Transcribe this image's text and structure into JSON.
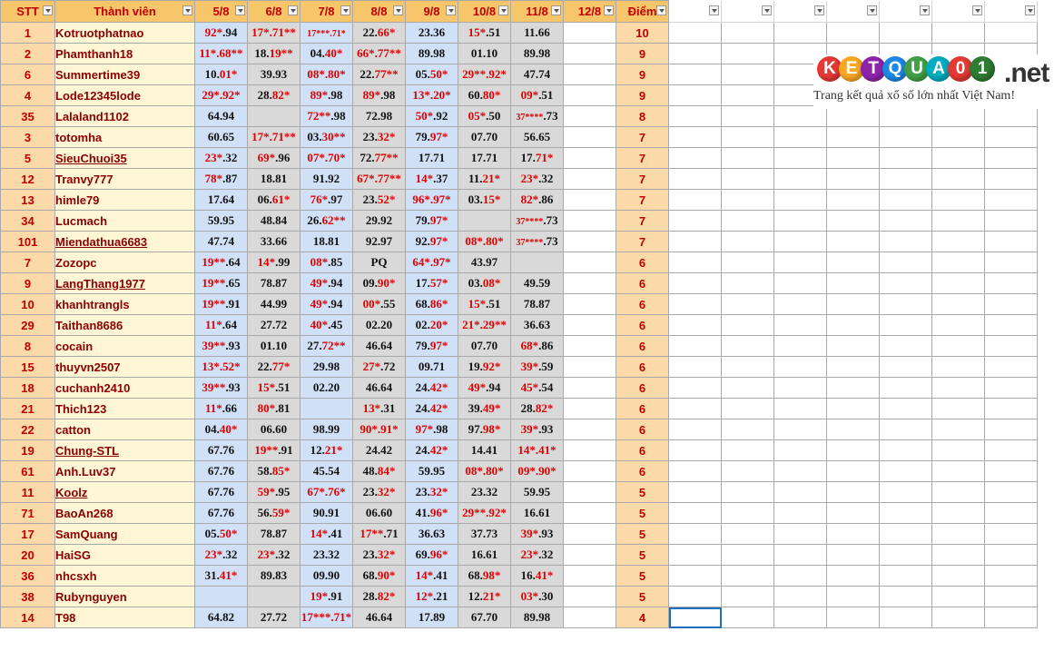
{
  "sheet": {
    "headers": {
      "stt": "STT",
      "name": "Thành viên",
      "dates": [
        "5/8",
        "6/8",
        "7/8",
        "8/8",
        "9/8",
        "10/8",
        "11/8",
        "12/8"
      ],
      "score": "Điểm"
    },
    "rows": [
      {
        "stt": "1",
        "name": "Kotruotphatnao",
        "link": false,
        "vals": [
          [
            "92*",
            ".94"
          ],
          [
            "17*.71**"
          ],
          [
            "$17***.71*"
          ],
          [
            "22.",
            "66*"
          ],
          [
            "23.36"
          ],
          [
            "15*",
            ".51"
          ],
          [
            "11.66"
          ],
          [
            ""
          ]
        ],
        "score": "10"
      },
      {
        "stt": "2",
        "name": "Phamthanh18",
        "link": false,
        "vals": [
          [
            "11*.68**"
          ],
          [
            "18.",
            "19**"
          ],
          [
            "04.",
            "40*"
          ],
          [
            "66*.77**"
          ],
          [
            "89.98"
          ],
          [
            "01.10"
          ],
          [
            "89.98"
          ],
          [
            ""
          ]
        ],
        "score": "9"
      },
      {
        "stt": "6",
        "name": "Summertime39",
        "link": false,
        "vals": [
          [
            "10.",
            "01*"
          ],
          [
            "39.93"
          ],
          [
            "08*.80*"
          ],
          [
            "22.",
            "77**"
          ],
          [
            "05.",
            "50*"
          ],
          [
            "29**.92*"
          ],
          [
            "47.74"
          ],
          [
            ""
          ]
        ],
        "score": "9"
      },
      {
        "stt": "4",
        "name": "Lode12345lode",
        "link": false,
        "vals": [
          [
            "29*.92*"
          ],
          [
            "28.",
            "82*"
          ],
          [
            "89*",
            ".98"
          ],
          [
            "89*",
            ".98"
          ],
          [
            "13*.20*"
          ],
          [
            "60.",
            "80*"
          ],
          [
            "09*",
            ".51"
          ],
          [
            ""
          ]
        ],
        "score": "9"
      },
      {
        "stt": "35",
        "name": "Lalaland1102",
        "link": false,
        "vals": [
          [
            "64.94"
          ],
          [
            ""
          ],
          [
            "72**",
            ".98"
          ],
          [
            "72.98"
          ],
          [
            "50*",
            ".92"
          ],
          [
            "05*",
            ".50"
          ],
          [
            "$37****",
            ".73"
          ],
          [
            ""
          ]
        ],
        "score": "8"
      },
      {
        "stt": "3",
        "name": "totomha",
        "link": false,
        "vals": [
          [
            "60.65"
          ],
          [
            "17*.71**"
          ],
          [
            "03.",
            "30**"
          ],
          [
            "23.",
            "32*"
          ],
          [
            "79.",
            "97*"
          ],
          [
            "07.70"
          ],
          [
            "56.65"
          ],
          [
            ""
          ]
        ],
        "score": "7"
      },
      {
        "stt": "5",
        "name": "SieuChuoi35",
        "link": true,
        "vals": [
          [
            "23*",
            ".32"
          ],
          [
            "69*",
            ".96"
          ],
          [
            "07*.70*"
          ],
          [
            "72.",
            "77**"
          ],
          [
            "17.71"
          ],
          [
            "17.71"
          ],
          [
            "17.",
            "71*"
          ],
          [
            ""
          ]
        ],
        "score": "7"
      },
      {
        "stt": "12",
        "name": "Tranvy777",
        "link": false,
        "vals": [
          [
            "78*",
            ".87"
          ],
          [
            "18.81"
          ],
          [
            "91.92"
          ],
          [
            "67*.77**"
          ],
          [
            "14*",
            ".37"
          ],
          [
            "11.",
            "21*"
          ],
          [
            "23*",
            ".32"
          ],
          [
            ""
          ]
        ],
        "score": "7"
      },
      {
        "stt": "13",
        "name": "himle79",
        "link": false,
        "vals": [
          [
            "17.64"
          ],
          [
            "06.",
            "61*"
          ],
          [
            "76*",
            ".97"
          ],
          [
            "23.",
            "52*"
          ],
          [
            "96*.97*"
          ],
          [
            "03.",
            "15*"
          ],
          [
            "82*",
            ".86"
          ],
          [
            ""
          ]
        ],
        "score": "7"
      },
      {
        "stt": "34",
        "name": "Lucmach",
        "link": false,
        "vals": [
          [
            "59.95"
          ],
          [
            "48.84"
          ],
          [
            "26.",
            "62**"
          ],
          [
            "29.92"
          ],
          [
            "79.",
            "97*"
          ],
          [
            ""
          ],
          [
            "$37****",
            ".73"
          ],
          [
            ""
          ]
        ],
        "score": "7"
      },
      {
        "stt": "101",
        "name": "Miendathua6683",
        "link": true,
        "vals": [
          [
            "47.74"
          ],
          [
            "33.66"
          ],
          [
            "18.81"
          ],
          [
            "92.97"
          ],
          [
            "92.",
            "97*"
          ],
          [
            "08*.80*"
          ],
          [
            "$37****",
            ".73"
          ],
          [
            ""
          ]
        ],
        "score": "7"
      },
      {
        "stt": "7",
        "name": "Zozopc",
        "link": false,
        "vals": [
          [
            "19**",
            ".64"
          ],
          [
            "14*",
            ".99"
          ],
          [
            "08*",
            ".85"
          ],
          [
            "PQ"
          ],
          [
            "64*.97*"
          ],
          [
            "43.97"
          ],
          [
            ""
          ],
          [
            ""
          ]
        ],
        "score": "6"
      },
      {
        "stt": "9",
        "name": "LangThang1977",
        "link": true,
        "vals": [
          [
            "19**",
            ".65"
          ],
          [
            "78.87"
          ],
          [
            "49*",
            ".94"
          ],
          [
            "09.",
            "90*"
          ],
          [
            "17.",
            "57*"
          ],
          [
            "03.",
            "08*"
          ],
          [
            "49.59"
          ],
          [
            ""
          ]
        ],
        "score": "6"
      },
      {
        "stt": "10",
        "name": "khanhtrangls",
        "link": false,
        "vals": [
          [
            "19**",
            ".91"
          ],
          [
            "44.99"
          ],
          [
            "49*",
            ".94"
          ],
          [
            "00*",
            ".55"
          ],
          [
            "68.",
            "86*"
          ],
          [
            "15*",
            ".51"
          ],
          [
            "78.87"
          ],
          [
            ""
          ]
        ],
        "score": "6"
      },
      {
        "stt": "29",
        "name": "Taithan8686",
        "link": false,
        "vals": [
          [
            "11*",
            ".64"
          ],
          [
            "27.72"
          ],
          [
            "40*",
            ".45"
          ],
          [
            "02.20"
          ],
          [
            "02.",
            "20*"
          ],
          [
            "21*.29**"
          ],
          [
            "36.63"
          ],
          [
            ""
          ]
        ],
        "score": "6"
      },
      {
        "stt": "8",
        "name": "cocain",
        "link": false,
        "vals": [
          [
            "39**",
            ".93"
          ],
          [
            "01.10"
          ],
          [
            "27.",
            "72**"
          ],
          [
            "46.64"
          ],
          [
            "79.",
            "97*"
          ],
          [
            "07.70"
          ],
          [
            "68*",
            ".86"
          ],
          [
            ""
          ]
        ],
        "score": "6"
      },
      {
        "stt": "15",
        "name": "thuyvn2507",
        "link": false,
        "vals": [
          [
            "13*.52*"
          ],
          [
            "22.",
            "77*"
          ],
          [
            "29.98"
          ],
          [
            "27*",
            ".72"
          ],
          [
            "09.71"
          ],
          [
            "19.",
            "92*"
          ],
          [
            "39*",
            ".59"
          ],
          [
            ""
          ]
        ],
        "score": "6"
      },
      {
        "stt": "18",
        "name": "cuchanh2410",
        "link": false,
        "vals": [
          [
            "39**",
            ".93"
          ],
          [
            "15*",
            ".51"
          ],
          [
            "02.20"
          ],
          [
            "46.64"
          ],
          [
            "24.",
            "42*"
          ],
          [
            "49*",
            ".94"
          ],
          [
            "45*",
            ".54"
          ],
          [
            ""
          ]
        ],
        "score": "6"
      },
      {
        "stt": "21",
        "name": "Thich123",
        "link": false,
        "vals": [
          [
            "11*",
            ".66"
          ],
          [
            "80*",
            ".81"
          ],
          [
            ""
          ],
          [
            "13*",
            ".31"
          ],
          [
            "24.",
            "42*"
          ],
          [
            "39.",
            "49*"
          ],
          [
            "28.",
            "82*"
          ],
          [
            ""
          ]
        ],
        "score": "6"
      },
      {
        "stt": "22",
        "name": "catton",
        "link": false,
        "vals": [
          [
            "04.",
            "40*"
          ],
          [
            "06.60"
          ],
          [
            "98.99"
          ],
          [
            "90*.91*"
          ],
          [
            "97*",
            ".98"
          ],
          [
            "97.",
            "98*"
          ],
          [
            "39*",
            ".93"
          ],
          [
            ""
          ]
        ],
        "score": "6"
      },
      {
        "stt": "19",
        "name": "Chung-STL",
        "link": true,
        "vals": [
          [
            "67.76"
          ],
          [
            "19**",
            ".91"
          ],
          [
            "12.",
            "21*"
          ],
          [
            "24.42"
          ],
          [
            "24.",
            "42*"
          ],
          [
            "14.41"
          ],
          [
            "14*.41*"
          ],
          [
            ""
          ]
        ],
        "score": "6"
      },
      {
        "stt": "61",
        "name": "Anh.Luv37",
        "link": false,
        "vals": [
          [
            "67.76"
          ],
          [
            "58.",
            "85*"
          ],
          [
            "45.54"
          ],
          [
            "48.",
            "84*"
          ],
          [
            "59.95"
          ],
          [
            "08*.80*"
          ],
          [
            "09*.90*"
          ],
          [
            ""
          ]
        ],
        "score": "6"
      },
      {
        "stt": "11",
        "name": "Koolz",
        "link": true,
        "vals": [
          [
            "67.76"
          ],
          [
            "59*",
            ".95"
          ],
          [
            "67*.76*"
          ],
          [
            "23.",
            "32*"
          ],
          [
            "23.",
            "32*"
          ],
          [
            "23.32"
          ],
          [
            "59.95"
          ],
          [
            ""
          ]
        ],
        "score": "5"
      },
      {
        "stt": "71",
        "name": "BaoAn268",
        "link": false,
        "vals": [
          [
            "67.76"
          ],
          [
            "56.",
            "59*"
          ],
          [
            "90.91"
          ],
          [
            "06.60"
          ],
          [
            "41.",
            "96*"
          ],
          [
            "29**.92*"
          ],
          [
            "16.61"
          ],
          [
            ""
          ]
        ],
        "score": "5"
      },
      {
        "stt": "17",
        "name": "SamQuang",
        "link": false,
        "vals": [
          [
            "05.",
            "50*"
          ],
          [
            "78.87"
          ],
          [
            "14*",
            ".41"
          ],
          [
            "17**",
            ".71"
          ],
          [
            "36.63"
          ],
          [
            "37.73"
          ],
          [
            "39*",
            ".93"
          ],
          [
            ""
          ]
        ],
        "score": "5"
      },
      {
        "stt": "20",
        "name": "HaiSG",
        "link": false,
        "vals": [
          [
            "23*",
            ".32"
          ],
          [
            "23*",
            ".32"
          ],
          [
            "23.32"
          ],
          [
            "23.",
            "32*"
          ],
          [
            "69.",
            "96*"
          ],
          [
            "16.61"
          ],
          [
            "23*",
            ".32"
          ],
          [
            ""
          ]
        ],
        "score": "5"
      },
      {
        "stt": "36",
        "name": "nhcsxh",
        "link": false,
        "vals": [
          [
            "31.",
            "41*"
          ],
          [
            "89.83"
          ],
          [
            "09.90"
          ],
          [
            "68.",
            "90*"
          ],
          [
            "14*",
            ".41"
          ],
          [
            "68.",
            "98*"
          ],
          [
            "16.",
            "41*"
          ],
          [
            ""
          ]
        ],
        "score": "5"
      },
      {
        "stt": "38",
        "name": "Rubynguyen",
        "link": false,
        "vals": [
          [
            ""
          ],
          [
            ""
          ],
          [
            "19*",
            ".91"
          ],
          [
            "28.",
            "82*"
          ],
          [
            "12*",
            ".21"
          ],
          [
            "12.",
            "21*"
          ],
          [
            "03*",
            ".30"
          ],
          [
            ""
          ]
        ],
        "score": "5"
      },
      {
        "stt": "14",
        "name": "T98",
        "link": false,
        "vals": [
          [
            "64.82"
          ],
          [
            "27.72"
          ],
          [
            "17***.71*"
          ],
          [
            "46.64"
          ],
          [
            "17.89"
          ],
          [
            "67.70"
          ],
          [
            "89.98"
          ],
          [
            ""
          ]
        ],
        "score": "4"
      }
    ]
  },
  "logo": {
    "letters": [
      "K",
      "E",
      "T",
      "Q",
      "U",
      "A",
      "0",
      "1"
    ],
    "colors": [
      "#e53935",
      "#f9a825",
      "#8e24aa",
      "#1e88e5",
      "#43a047",
      "#00acc1",
      "#e53935",
      "#2e7d32"
    ],
    "suffix": ".net",
    "tagline": "Trang kết quả xổ số lớn nhất Việt Nam!"
  }
}
